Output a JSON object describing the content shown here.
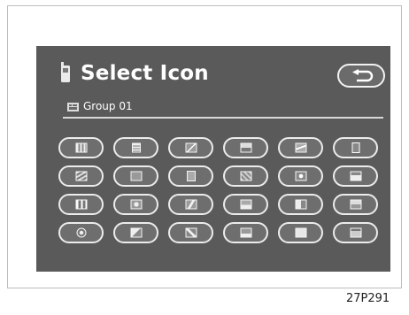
{
  "header": {
    "title": "Select Icon",
    "group_label": "Group 01"
  },
  "grid": {
    "rows": [
      [
        "calculator-icon",
        "document-icon",
        "slash-icon",
        "landscape-icon",
        "wave-icon",
        "book-icon"
      ],
      [
        "stripes-icon",
        "signboard-icon",
        "card-icon",
        "diagonal-icon",
        "heart-icon",
        "house-icon"
      ],
      [
        "fork-knife-icon",
        "cup-icon",
        "bolt-icon",
        "box-icon",
        "pages-icon",
        "symbol-icon"
      ],
      [
        "coin-icon",
        "pen-icon",
        "tool-icon",
        "flask-icon",
        "note-icon",
        "tv-icon"
      ]
    ]
  },
  "figure_code": "27P291",
  "colors": {
    "screen_bg": "#5a5a5a",
    "button_bg": "#6e6e6e",
    "outline": "#ececec",
    "text": "#ffffff"
  }
}
